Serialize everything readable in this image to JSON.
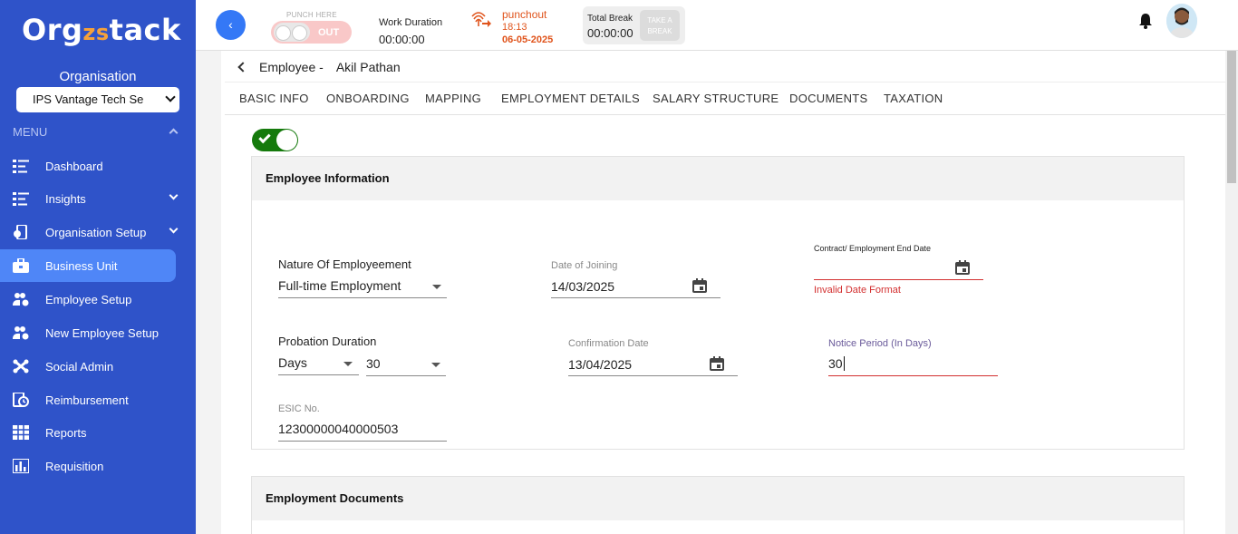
{
  "sidebar": {
    "logo_a": "Org",
    "logo_b": "zs",
    "logo_c": "tack",
    "org_label": "Organisation",
    "org_value": "IPS Vantage Tech Se",
    "menu_label": "MENU",
    "items": [
      {
        "label": "Dashboard",
        "icon": "list-icon"
      },
      {
        "label": "Insights",
        "icon": "list-icon"
      },
      {
        "label": "Organisation Setup",
        "icon": "device-settings-icon"
      },
      {
        "label": "Business Unit",
        "icon": "briefcase-icon"
      },
      {
        "label": "Employee Setup",
        "icon": "users-gear-icon"
      },
      {
        "label": "New Employee Setup",
        "icon": "users-gear-icon"
      },
      {
        "label": "Social Admin",
        "icon": "joomla-icon"
      },
      {
        "label": "Reimbursement",
        "icon": "document-clock-icon"
      },
      {
        "label": "Reports",
        "icon": "grid-icon"
      },
      {
        "label": "Requisition",
        "icon": "bar-chart-icon"
      }
    ],
    "active_item": "Business Unit"
  },
  "topbar": {
    "back_glyph": "‹",
    "punch_here": "PUNCH HERE",
    "punch_out": "OUT",
    "work_duration_label": "Work Duration",
    "work_duration_value": "00:00:00",
    "punchout_label": "punchout",
    "punchout_time": "18:13",
    "punchout_date": "06-05-2025",
    "total_break_label": "Total Break",
    "total_break_value": "00:00:00",
    "take_break_line1": "TAKE A",
    "take_break_line2": "BREAK"
  },
  "page": {
    "breadcrumb_prefix": "Employee -",
    "employee_name": "Akil Pathan",
    "tabs": [
      "BASIC INFO",
      "ONBOARDING",
      "MAPPING",
      "EMPLOYMENT DETAILS",
      "SALARY STRUCTURE",
      "DOCUMENTS",
      "TAXATION"
    ]
  },
  "employee_info": {
    "title": "Employee Information",
    "nature_label": "Nature Of Employeement",
    "nature_value": "Full-time Employment",
    "doj_label": "Date of Joining",
    "doj_value": "14/03/2025",
    "end_date_label": "Contract/ Employment End Date",
    "end_date_value": "",
    "end_date_error": "Invalid Date Format",
    "probation_label": "Probation Duration",
    "probation_unit": "Days",
    "probation_value": "30",
    "confirmation_label": "Confirmation Date",
    "confirmation_value": "13/04/2025",
    "notice_label": "Notice Period (In Days)",
    "notice_value": "30",
    "esic_label": "ESIC No.",
    "esic_value": "12300000040000503"
  },
  "employment_documents": {
    "title": "Employment Documents"
  },
  "colors": {
    "sidebar_bg": "#2f53c9",
    "active_item": "#4f86f7",
    "accent_orange": "#e0541c",
    "toggle_green": "#157a0c",
    "error_red": "#d32f2f"
  }
}
